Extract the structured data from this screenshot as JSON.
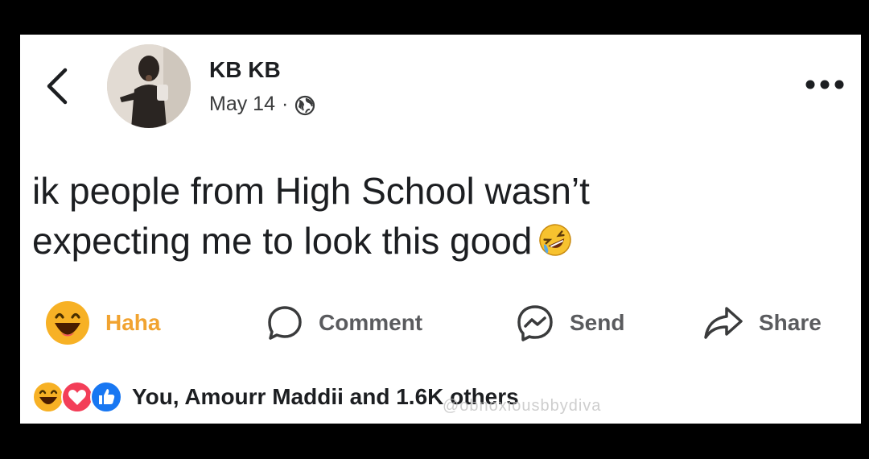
{
  "post": {
    "author": "KB KB",
    "date": "May 14",
    "separator": "·",
    "privacy_icon": "globe-icon",
    "text_line1": "ik people from High School wasn’t",
    "text_line2": "expecting me to look this good",
    "emoji": "rolling-on-floor-laughing"
  },
  "actions": {
    "haha_label": "Haha",
    "comment_label": "Comment",
    "send_label": "Send",
    "share_label": "Share"
  },
  "reactions": {
    "summary": "You, Amourr Maddii and 1.6K others",
    "types": [
      "haha",
      "love",
      "like"
    ]
  },
  "watermark": "@obnoxiousbbydiva",
  "colors": {
    "haha": "#f7b125",
    "love": "#f33e58",
    "like": "#1877f2",
    "text": "#1c1e21"
  }
}
